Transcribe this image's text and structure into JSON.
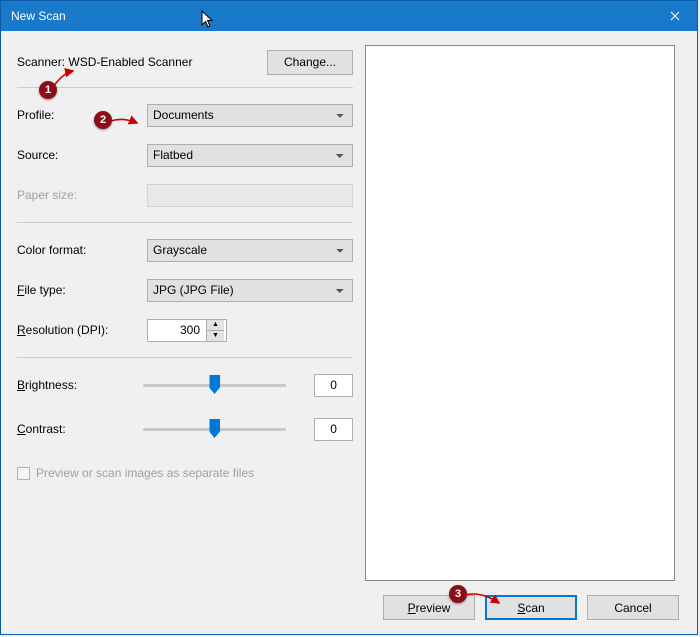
{
  "window": {
    "title": "New Scan"
  },
  "scanner": {
    "label_prefix": "Scanner: ",
    "name": "WSD-Enabled Scanner",
    "change_btn": "Change..."
  },
  "profile": {
    "label": "Profile:",
    "value": "Documents"
  },
  "source": {
    "label": "Source:",
    "value": "Flatbed"
  },
  "paper_size": {
    "label": "Paper size:",
    "value": ""
  },
  "color_format": {
    "label": "Color format:",
    "value": "Grayscale"
  },
  "file_type": {
    "label": "File type:",
    "value": "JPG (JPG File)"
  },
  "resolution": {
    "label": "Resolution (DPI):",
    "value": "300"
  },
  "brightness": {
    "label": "Brightness:",
    "value": "0"
  },
  "contrast": {
    "label": "Contrast:",
    "value": "0"
  },
  "separate_files": {
    "label": "Preview or scan images as separate files"
  },
  "buttons": {
    "preview": "Preview",
    "scan": "Scan",
    "cancel": "Cancel"
  },
  "annotations": {
    "a1": "1",
    "a2": "2",
    "a3": "3"
  }
}
